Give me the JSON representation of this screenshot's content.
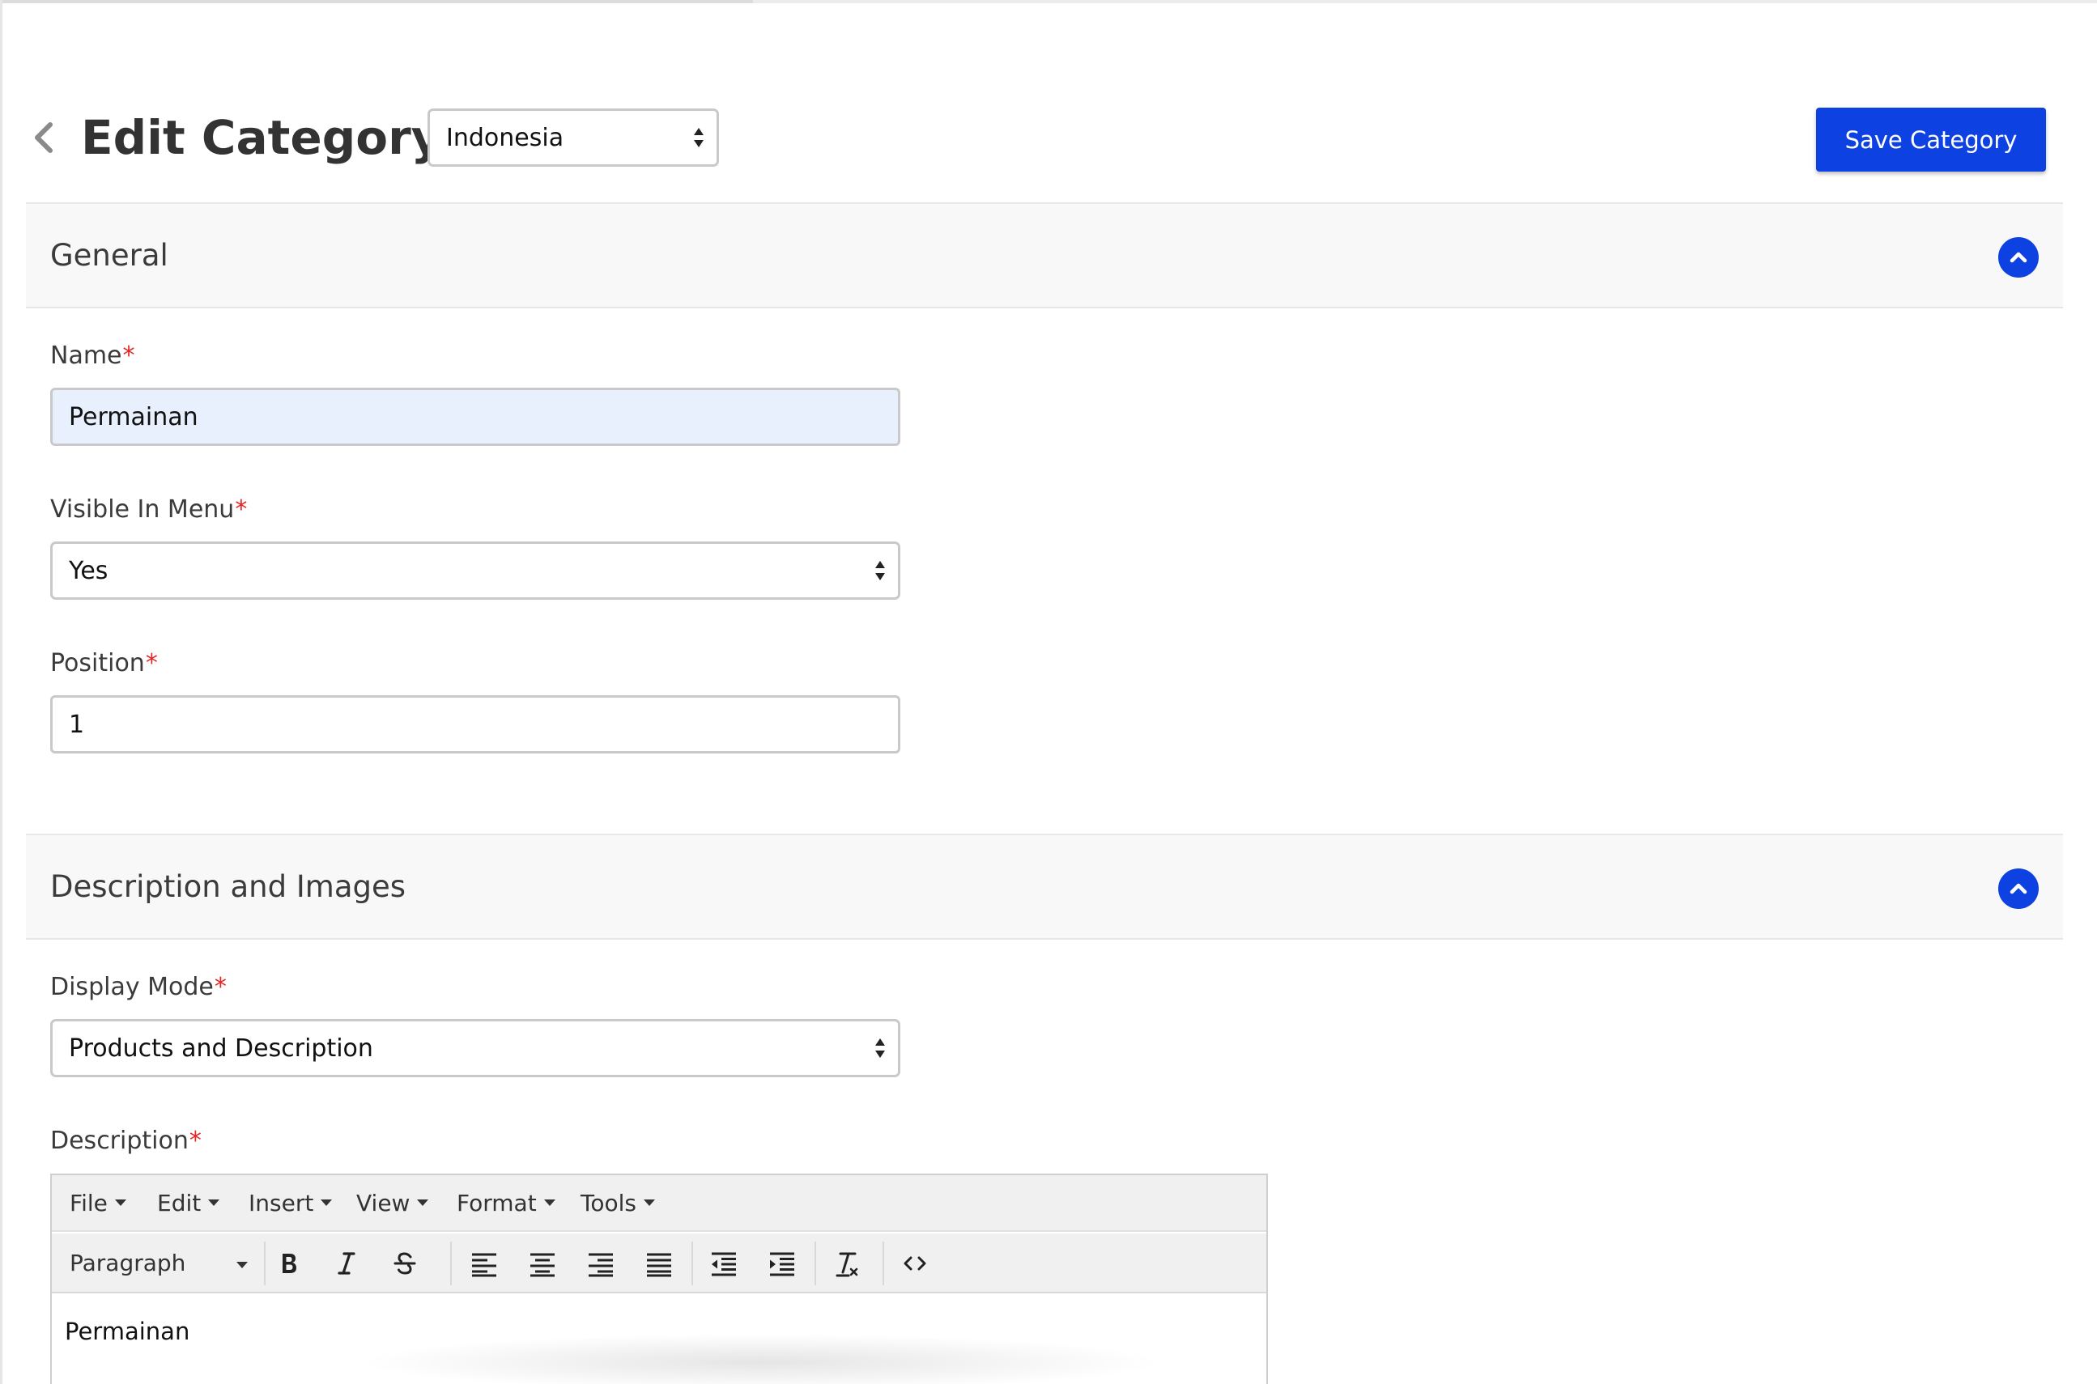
{
  "header": {
    "title": "Edit Category",
    "locale": "Indonesia",
    "save_label": "Save Category"
  },
  "general": {
    "title": "General",
    "name_label": "Name",
    "name_value": "Permainan",
    "visible_label": "Visible In Menu",
    "visible_value": "Yes",
    "position_label": "Position",
    "position_value": "1"
  },
  "description_section": {
    "title": "Description and Images",
    "display_mode_label": "Display Mode",
    "display_mode_value": "Products and Description",
    "description_label": "Description"
  },
  "editor": {
    "menus": [
      "File",
      "Edit",
      "Insert",
      "View",
      "Format",
      "Tools"
    ],
    "block_format": "Paragraph",
    "content": "Permainan"
  },
  "required_mark": "*",
  "colors": {
    "accent": "#0d41e1",
    "required": "#e52424",
    "autofill_bg": "#e8f0fe"
  }
}
